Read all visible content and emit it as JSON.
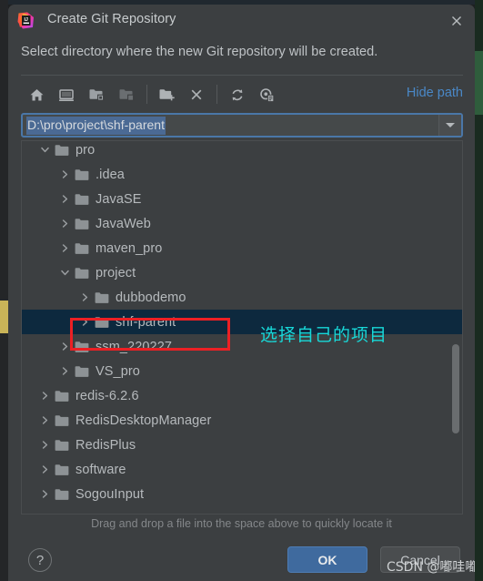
{
  "window": {
    "title": "Create Git Repository",
    "app_icon": "intellij-idea-logo",
    "close_icon": "close-icon",
    "subtitle": "Select directory where the new Git repository will be created."
  },
  "toolbar": {
    "buttons": [
      {
        "name": "home-icon",
        "tooltip": "Home"
      },
      {
        "name": "desktop-icon",
        "tooltip": "Desktop"
      },
      {
        "name": "project-folder-icon",
        "tooltip": "Project Directory"
      },
      {
        "name": "module-folder-icon",
        "tooltip": "Module Directory"
      },
      {
        "name": "new-folder-icon",
        "tooltip": "New Folder"
      },
      {
        "name": "delete-icon",
        "tooltip": "Delete"
      },
      {
        "name": "refresh-icon",
        "tooltip": "Refresh"
      },
      {
        "name": "show-hidden-files-icon",
        "tooltip": "Show Hidden Files"
      }
    ],
    "hide_path_label": "Hide path"
  },
  "path_field": {
    "value": "D:\\pro\\project\\shf-parent",
    "placeholder": "",
    "selected": true,
    "dropdown_icon": "chevron-down-icon"
  },
  "tree": {
    "rows": [
      {
        "label": "pro",
        "depth": 1,
        "state": "expanded",
        "selected": false
      },
      {
        "label": ".idea",
        "depth": 2,
        "state": "collapsed",
        "selected": false
      },
      {
        "label": "JavaSE",
        "depth": 2,
        "state": "collapsed",
        "selected": false
      },
      {
        "label": "JavaWeb",
        "depth": 2,
        "state": "collapsed",
        "selected": false
      },
      {
        "label": "maven_pro",
        "depth": 2,
        "state": "collapsed",
        "selected": false
      },
      {
        "label": "project",
        "depth": 2,
        "state": "expanded",
        "selected": false
      },
      {
        "label": "dubbodemo",
        "depth": 3,
        "state": "collapsed",
        "selected": false
      },
      {
        "label": "shf-parent",
        "depth": 3,
        "state": "collapsed",
        "selected": true
      },
      {
        "label": "ssm_220227",
        "depth": 2,
        "state": "collapsed",
        "selected": false
      },
      {
        "label": "VS_pro",
        "depth": 2,
        "state": "collapsed",
        "selected": false
      },
      {
        "label": "redis-6.2.6",
        "depth": 1,
        "state": "collapsed",
        "selected": false
      },
      {
        "label": "RedisDesktopManager",
        "depth": 1,
        "state": "collapsed",
        "selected": false
      },
      {
        "label": "RedisPlus",
        "depth": 1,
        "state": "collapsed",
        "selected": false
      },
      {
        "label": "software",
        "depth": 1,
        "state": "collapsed",
        "selected": false
      },
      {
        "label": "SogouInput",
        "depth": 1,
        "state": "collapsed",
        "selected": false
      }
    ],
    "scrollbar": "vertical-scrollbar"
  },
  "hint": "Drag and drop a file into the space above to quickly locate it",
  "footer": {
    "help_label": "?",
    "ok_label": "OK",
    "cancel_label": "Cancel"
  },
  "annotations": {
    "callout_text": "选择自己的项目",
    "callout_color": "#18d8d8",
    "box_color": "#ec2024",
    "watermark": "CSDN @嘟哇嘟"
  },
  "colors": {
    "dialog_bg": "#3c3f41",
    "accent_blue": "#4a88c7",
    "selection_row": "#0d293e",
    "selection_text": "#4b6a94",
    "ok_button": "#3f6a9e"
  }
}
